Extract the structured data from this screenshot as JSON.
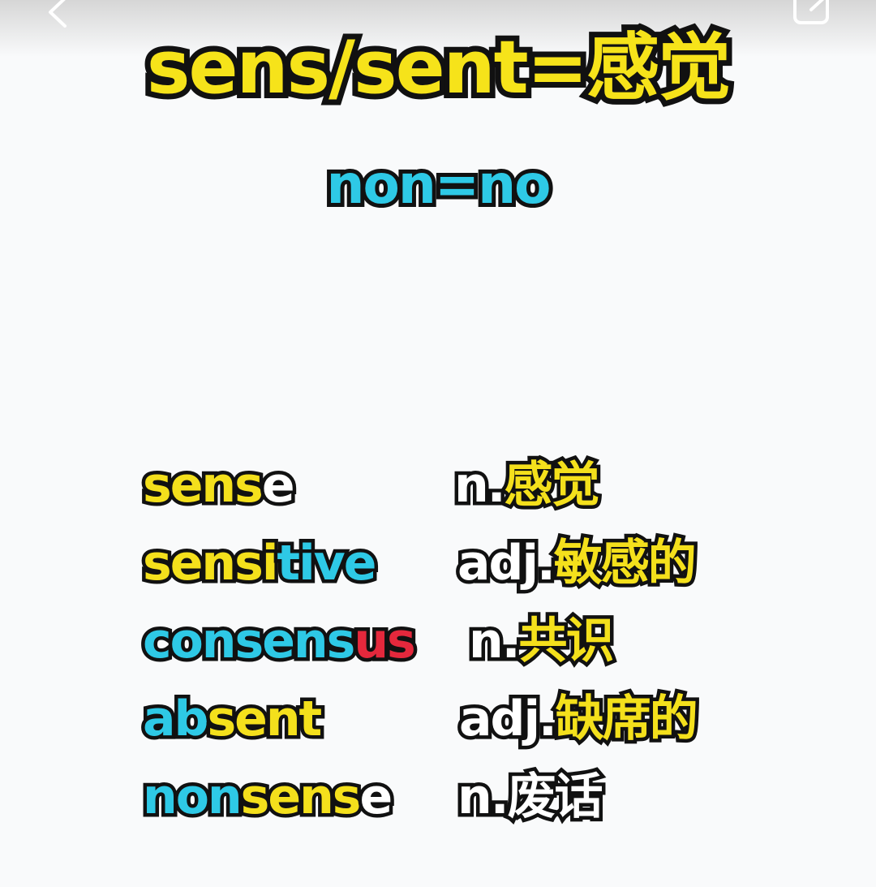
{
  "title": "sens/sent=感觉",
  "subtitle": "non=no",
  "vocab": [
    {
      "word_parts": [
        {
          "text": "sens",
          "color": "#f4e01c"
        },
        {
          "text": "e",
          "color": "#ffffff"
        }
      ],
      "pos": "n.",
      "meaning": "感觉"
    },
    {
      "word_parts": [
        {
          "text": "sensi",
          "color": "#f4e01c"
        },
        {
          "text": "tive",
          "color": "#2ec9e6"
        }
      ],
      "pos": "adj.",
      "meaning": "敏感的"
    },
    {
      "word_parts": [
        {
          "text": "consens",
          "color": "#2ec9e6"
        },
        {
          "text": "us",
          "color": "#e5283c"
        }
      ],
      "pos": "n.",
      "meaning": "共识"
    },
    {
      "word_parts": [
        {
          "text": "ab",
          "color": "#2ec9e6"
        },
        {
          "text": "sent",
          "color": "#f4e01c"
        }
      ],
      "pos": "adj.",
      "meaning": "缺席的"
    },
    {
      "word_parts": [
        {
          "text": "non",
          "color": "#2ec9e6"
        },
        {
          "text": "sens",
          "color": "#f4e01c"
        },
        {
          "text": "e",
          "color": "#ffffff"
        }
      ],
      "pos": "n.",
      "meaning": "废话"
    }
  ],
  "colors": {
    "outline": "#111111",
    "background": "#f9fafb",
    "yellow": "#f4e01c",
    "cyan": "#2ec9e6",
    "red": "#e5283c",
    "white": "#ffffff"
  },
  "icons": {
    "back": "chevron-left-icon",
    "share": "share-icon"
  }
}
